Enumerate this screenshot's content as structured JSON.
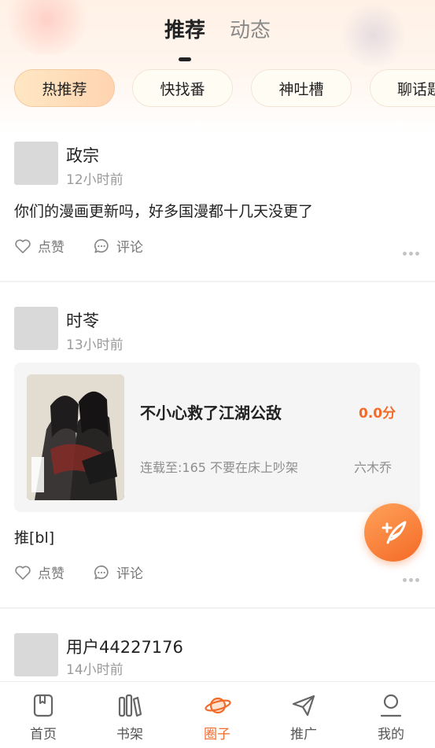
{
  "top_tabs": [
    {
      "label": "推荐",
      "active": true
    },
    {
      "label": "动态",
      "active": false
    }
  ],
  "chips": [
    {
      "label": "热推荐",
      "active": true
    },
    {
      "label": "快找番",
      "active": false
    },
    {
      "label": "神吐槽",
      "active": false
    },
    {
      "label": "聊话题",
      "active": false
    }
  ],
  "posts": [
    {
      "username": "政宗",
      "time": "12小时前",
      "content": "你们的漫画更新吗，好多国漫都十几天没更了",
      "like_label": "点赞",
      "comment_label": "评论"
    },
    {
      "username": "时苓",
      "time": "13小时前",
      "book": {
        "title": "不小心救了江湖公敌",
        "score": "0.0分",
        "update": "连载至:165 不要在床上吵架",
        "author": "六木乔"
      },
      "content": "推[bl]",
      "like_label": "点赞",
      "comment_label": "评论"
    },
    {
      "username": "用户44227176",
      "time": "14小时前"
    }
  ],
  "fab": {
    "icon": "quill-plus-icon"
  },
  "bottom_nav": [
    {
      "label": "首页",
      "icon": "home-book-icon",
      "active": false
    },
    {
      "label": "书架",
      "icon": "bookshelf-icon",
      "active": false
    },
    {
      "label": "圈子",
      "icon": "planet-icon",
      "active": true
    },
    {
      "label": "推广",
      "icon": "paper-plane-icon",
      "active": false
    },
    {
      "label": "我的",
      "icon": "user-icon",
      "active": false
    }
  ],
  "colors": {
    "accent": "#f26b2a",
    "chip_active": "#ffd4b0",
    "avatar_placeholder": "#d9d9d9"
  }
}
